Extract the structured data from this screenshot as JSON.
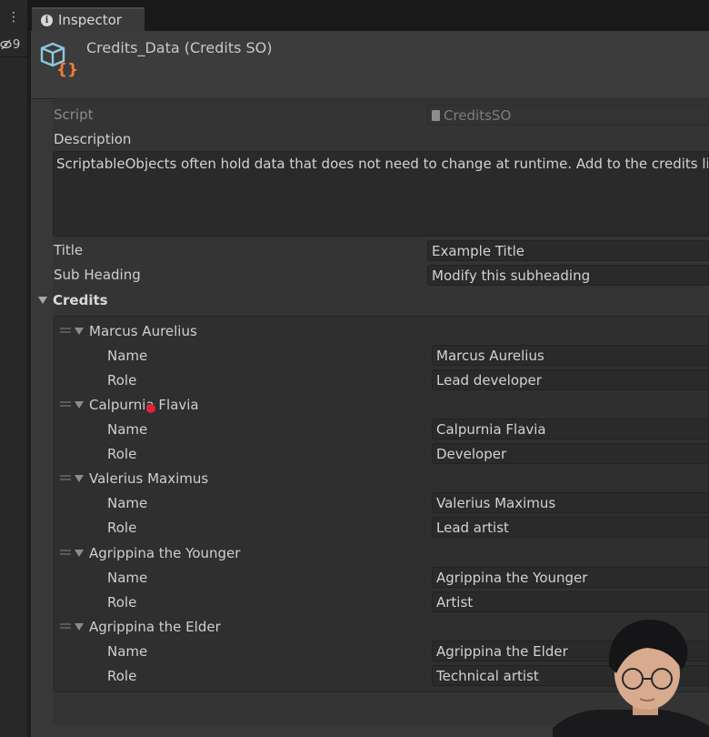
{
  "left_strip": {
    "kebab": "⋮",
    "hidden_count": "9"
  },
  "tab": {
    "label": "Inspector"
  },
  "header": {
    "title": "Credits_Data (Credits SO)"
  },
  "fields": {
    "script_label": "Script",
    "script_value": "CreditsSO",
    "description_label": "Description",
    "description_value": "ScriptableObjects often hold data that does not need to change at runtime. Add to the credits lis",
    "title_label": "Title",
    "title_value": "Example Title",
    "subheading_label": "Sub Heading",
    "subheading_value": "Modify this subheading"
  },
  "credits": {
    "label": "Credits",
    "name_label": "Name",
    "role_label": "Role",
    "items": [
      {
        "header": "Marcus Aurelius",
        "name": "Marcus Aurelius",
        "role": "Lead developer"
      },
      {
        "header": "Calpurnia Flavia",
        "name": "Calpurnia Flavia",
        "role": "Developer"
      },
      {
        "header": "Valerius Maximus",
        "name": "Valerius Maximus",
        "role": "Lead artist"
      },
      {
        "header": "Agrippina the Younger",
        "name": "Agrippina the Younger",
        "role": "Artist"
      },
      {
        "header": "Agrippina the Elder",
        "name": "Agrippina the Elder",
        "role": "Technical artist"
      }
    ]
  },
  "colors": {
    "panel": "#383838",
    "field": "#2a2a2a",
    "icon_cyan": "#8ec8dc",
    "icon_orange": "#f07a3c",
    "cursor_red": "#e3213c"
  }
}
